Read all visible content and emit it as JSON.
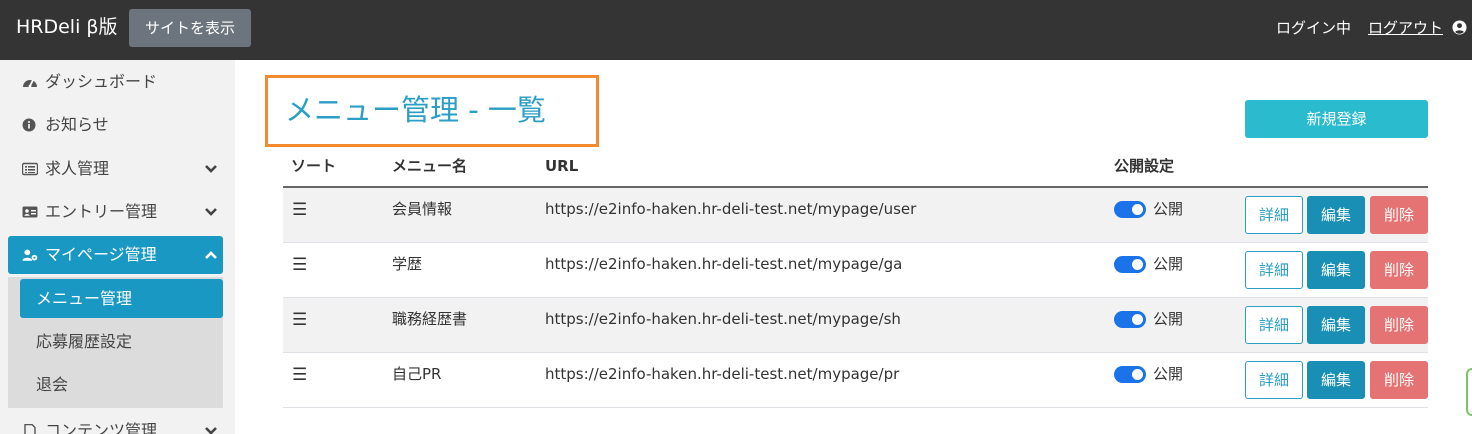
{
  "topbar": {
    "brand": "HRDeli β版",
    "view_site": "サイトを表示",
    "login_status": "ログイン中",
    "logout": "ログアウト"
  },
  "sidebar": {
    "items": [
      {
        "label": "ダッシュボード",
        "icon": "dashboard-icon"
      },
      {
        "label": "お知らせ",
        "icon": "info-icon"
      },
      {
        "label": "求人管理",
        "icon": "list-icon"
      },
      {
        "label": "エントリー管理",
        "icon": "id-card-icon"
      },
      {
        "label": "マイページ管理",
        "icon": "user-cog-icon"
      },
      {
        "label": "コンテンツ管理",
        "icon": "document-icon"
      }
    ],
    "submenu": [
      {
        "label": "メニュー管理"
      },
      {
        "label": "応募履歴設定"
      },
      {
        "label": "退会"
      }
    ]
  },
  "main": {
    "title": "メニュー管理 - 一覧",
    "new_button": "新規登録",
    "headers": {
      "sort": "ソート",
      "name": "メニュー名",
      "url": "URL",
      "publish": "公開設定"
    },
    "rows": [
      {
        "name": "会員情報",
        "url": "https://e2info-haken.hr-deli-test.net/mypage/user",
        "status": "公開"
      },
      {
        "name": "学歴",
        "url": "https://e2info-haken.hr-deli-test.net/mypage/ga",
        "status": "公開"
      },
      {
        "name": "職務経歴書",
        "url": "https://e2info-haken.hr-deli-test.net/mypage/sh",
        "status": "公開"
      },
      {
        "name": "自己PR",
        "url": "https://e2info-haken.hr-deli-test.net/mypage/pr",
        "status": "公開"
      }
    ],
    "actions": {
      "detail": "詳細",
      "edit": "編集",
      "delete": "削除"
    },
    "handle_glyph": "☰"
  },
  "colors": {
    "topbar": "#343434",
    "accent": "#1a98c4",
    "title": "#2a9ec5",
    "new_button": "#2bbbce",
    "delete": "#e57373",
    "highlight_box": "#f28a2e",
    "toggle_on": "#1a73e8"
  }
}
